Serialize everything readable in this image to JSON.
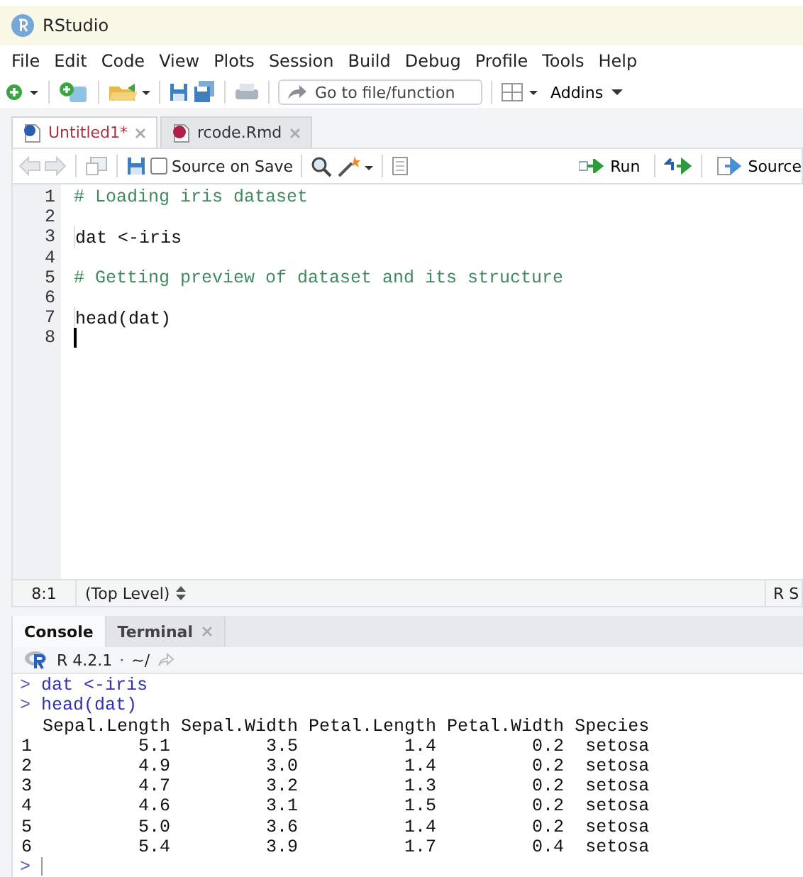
{
  "window": {
    "title": "RStudio"
  },
  "menu": [
    "File",
    "Edit",
    "Code",
    "View",
    "Plots",
    "Session",
    "Build",
    "Debug",
    "Profile",
    "Tools",
    "Help"
  ],
  "toolbar": {
    "goto_placeholder": "Go to file/function",
    "addins": "Addins"
  },
  "editor_tabs": [
    {
      "label": "Untitled1*",
      "kind": "r",
      "modified": true,
      "selected": true
    },
    {
      "label": "rcode.Rmd",
      "kind": "rmd",
      "modified": false,
      "selected": false
    }
  ],
  "editor_toolbar": {
    "source_on_save": {
      "label": "Source on Save",
      "checked": false
    },
    "run": "Run",
    "source": "Source"
  },
  "code": [
    {
      "number": "1",
      "kind": "comment",
      "text": "# Loading iris dataset"
    },
    {
      "number": "2",
      "kind": "blank"
    },
    {
      "number": "3",
      "kind": "code",
      "text": "dat <-iris"
    },
    {
      "number": "4",
      "kind": "blank"
    },
    {
      "number": "5",
      "kind": "comment",
      "text": "# Getting preview of dataset and its structure"
    },
    {
      "number": "6",
      "kind": "blank"
    },
    {
      "number": "7",
      "kind": "code",
      "text": "head(dat)"
    },
    {
      "number": "8",
      "kind": "blank",
      "cursor": true
    }
  ],
  "status_bar": {
    "position": "8:1",
    "scope": "(Top Level)",
    "file_type": "R S"
  },
  "console_tabs": [
    {
      "label": "Console",
      "closable": false,
      "selected": true
    },
    {
      "label": "Terminal",
      "closable": true,
      "selected": false
    }
  ],
  "console": {
    "version": "R 4.2.1",
    "separator": "·",
    "path": "~/",
    "prompt": ">",
    "lines": [
      {
        "kind": "input",
        "text": "dat <-iris"
      },
      {
        "kind": "input",
        "text": "head(dat)"
      },
      {
        "kind": "output",
        "text": "  Sepal.Length Sepal.Width Petal.Length Petal.Width Species"
      },
      {
        "kind": "output",
        "text": "1          5.1         3.5          1.4         0.2  setosa"
      },
      {
        "kind": "output",
        "text": "2          4.9         3.0          1.4         0.2  setosa"
      },
      {
        "kind": "output",
        "text": "3          4.7         3.2          1.3         0.2  setosa"
      },
      {
        "kind": "output",
        "text": "4          4.6         3.1          1.5         0.2  setosa"
      },
      {
        "kind": "output",
        "text": "5          5.0         3.6          1.4         0.2  setosa"
      },
      {
        "kind": "output",
        "text": "6          5.4         3.9          1.7         0.4  setosa"
      },
      {
        "kind": "input",
        "cursor": true
      }
    ]
  }
}
